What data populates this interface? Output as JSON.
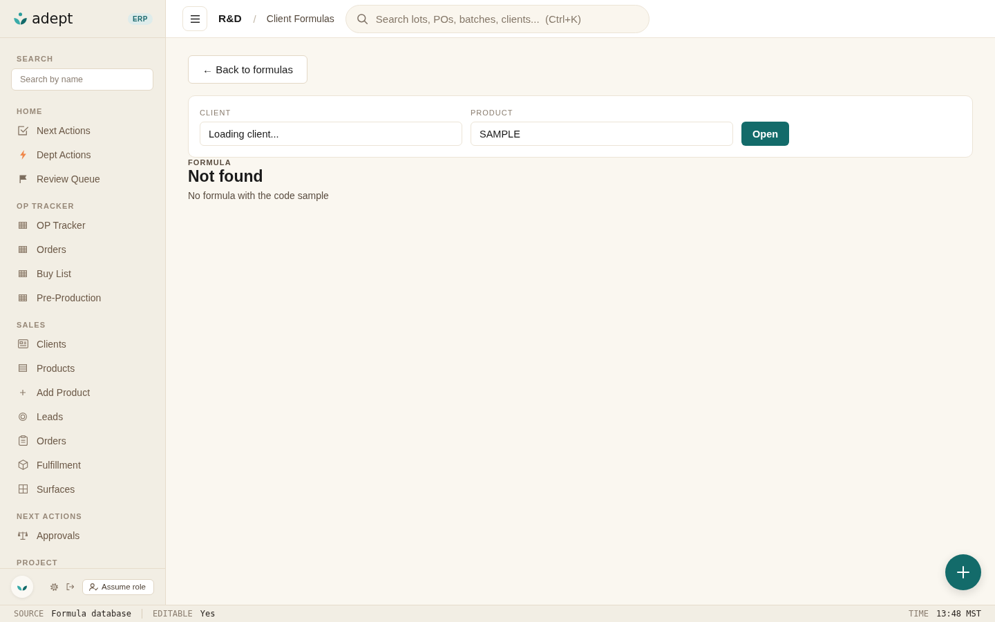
{
  "sidebar": {
    "brand": {
      "name": "adept",
      "badge": "ERP"
    },
    "search": {
      "title": "SEARCH",
      "placeholder": "Search by name"
    },
    "sections": [
      {
        "title": "HOME",
        "items": [
          {
            "label": "Next Actions",
            "kind": "check",
            "selected": false
          },
          {
            "label": "Dept Actions",
            "kind": "bolt",
            "selected": false
          },
          {
            "label": "Review Queue",
            "kind": "flag",
            "selected": false
          }
        ]
      },
      {
        "title": "OP TRACKER",
        "items": [
          {
            "label": "OP Tracker",
            "kind": "table",
            "selected": false
          },
          {
            "label": "Orders",
            "kind": "table",
            "selected": false
          },
          {
            "label": "Buy List",
            "kind": "table",
            "selected": false
          },
          {
            "label": "Pre-Production",
            "kind": "table",
            "selected": false
          }
        ]
      },
      {
        "title": "SALES",
        "items": [
          {
            "label": "Clients",
            "kind": "idcard",
            "selected": false
          },
          {
            "label": "Products",
            "kind": "list",
            "selected": false
          },
          {
            "label": "Add Product",
            "kind": "plus",
            "selected": false
          },
          {
            "label": "Leads",
            "kind": "ring",
            "selected": false
          },
          {
            "label": "Orders",
            "kind": "clipboard",
            "selected": false
          },
          {
            "label": "Fulfillment",
            "kind": "cube",
            "selected": false
          },
          {
            "label": "Surfaces",
            "kind": "grid",
            "selected": false
          }
        ]
      },
      {
        "title": "NEXT ACTIONS",
        "items": [
          {
            "label": "Approvals",
            "kind": "scales",
            "selected": false
          }
        ]
      },
      {
        "title": "PROJECT"
      }
    ],
    "footer": {
      "assume_role": "Assume role"
    }
  },
  "topbar": {
    "breadcrumb": {
      "section": "R&D",
      "separator": "/",
      "page": "Client Formulas"
    },
    "search": {
      "placeholder": "Search lots, POs, batches, clients...  (Ctrl+K)"
    }
  },
  "content": {
    "back": "← Back to formulas",
    "lookup": {
      "fields": [
        {
          "label": "CLIENT",
          "value": "Loading client..."
        },
        {
          "label": "PRODUCT",
          "value": "SAMPLE"
        }
      ],
      "submit": "Open"
    },
    "result": {
      "label": "FORMULA",
      "title": "Not found",
      "message": "No formula with the code sample"
    }
  },
  "status_bar": {
    "left": [
      {
        "label": "SOURCE",
        "value": "Formula database"
      },
      {
        "label": "EDITABLE",
        "value": "Yes"
      }
    ],
    "right": [
      {
        "label": "TIME",
        "value": "13:48 MST"
      }
    ]
  }
}
